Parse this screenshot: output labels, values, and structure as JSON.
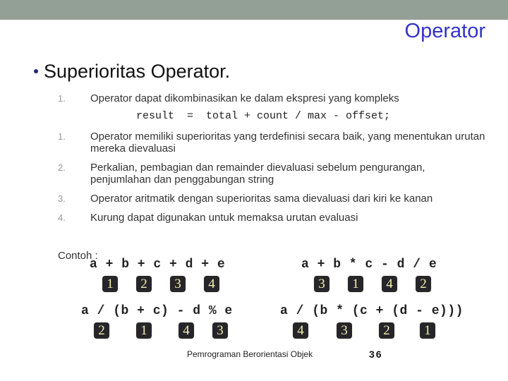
{
  "slide": {
    "title": "Operator",
    "heading": "Superioritas Operator.",
    "intro": {
      "num": "1.",
      "text": "Operator dapat dikombinasikan ke dalam ekspresi yang kompleks"
    },
    "code": "result  =  total + count / max - offset;",
    "items": [
      {
        "num": "1.",
        "text": "Operator memiliki superioritas yang terdefinisi secara baik, yang menentukan urutan mereka dievaluasi"
      },
      {
        "num": "2.",
        "text": "Perkalian, pembagian dan remainder dievaluasi sebelum pengurangan, penjumlahan dan penggabungan string"
      },
      {
        "num": "3.",
        "text": "Operator aritmatik dengan superioritas sama dievaluasi dari kiri ke kanan"
      },
      {
        "num": "4.",
        "text": "Kurung dapat digunakan untuk memaksa urutan evaluasi"
      }
    ],
    "example_label": "Contoh :",
    "examples": [
      {
        "expression": "a + b + c + d + e",
        "order": [
          "1",
          "2",
          "3",
          "4"
        ]
      },
      {
        "expression": "a + b * c - d / e",
        "order": [
          "3",
          "1",
          "4",
          "2"
        ]
      },
      {
        "expression": "a / (b + c) - d % e",
        "order": [
          "2",
          "1",
          "4",
          "3"
        ]
      },
      {
        "expression": "a / (b * (c + (d - e)))",
        "order": [
          "4",
          "3",
          "2",
          "1"
        ]
      }
    ],
    "footer": "Pemrograman Berorientasi Objek",
    "page_number": "36"
  },
  "colors": {
    "title": "#3333cc",
    "topbar": "#93a096",
    "badge_bg": "#26262a",
    "badge_text": "#f3eeb0"
  }
}
